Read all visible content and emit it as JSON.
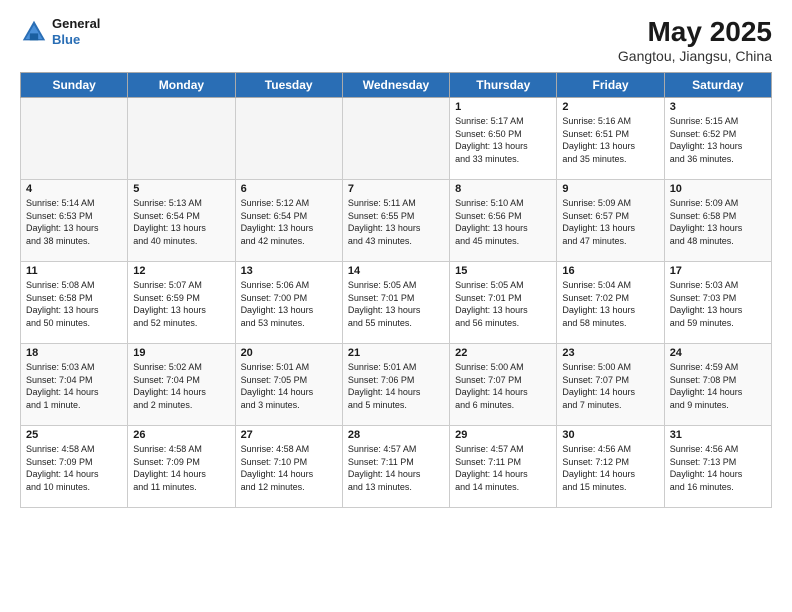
{
  "header": {
    "logo_general": "General",
    "logo_blue": "Blue",
    "title": "May 2025",
    "subtitle": "Gangtou, Jiangsu, China"
  },
  "days_of_week": [
    "Sunday",
    "Monday",
    "Tuesday",
    "Wednesday",
    "Thursday",
    "Friday",
    "Saturday"
  ],
  "weeks": [
    [
      {
        "day": "",
        "info": ""
      },
      {
        "day": "",
        "info": ""
      },
      {
        "day": "",
        "info": ""
      },
      {
        "day": "",
        "info": ""
      },
      {
        "day": "1",
        "info": "Sunrise: 5:17 AM\nSunset: 6:50 PM\nDaylight: 13 hours\nand 33 minutes."
      },
      {
        "day": "2",
        "info": "Sunrise: 5:16 AM\nSunset: 6:51 PM\nDaylight: 13 hours\nand 35 minutes."
      },
      {
        "day": "3",
        "info": "Sunrise: 5:15 AM\nSunset: 6:52 PM\nDaylight: 13 hours\nand 36 minutes."
      }
    ],
    [
      {
        "day": "4",
        "info": "Sunrise: 5:14 AM\nSunset: 6:53 PM\nDaylight: 13 hours\nand 38 minutes."
      },
      {
        "day": "5",
        "info": "Sunrise: 5:13 AM\nSunset: 6:54 PM\nDaylight: 13 hours\nand 40 minutes."
      },
      {
        "day": "6",
        "info": "Sunrise: 5:12 AM\nSunset: 6:54 PM\nDaylight: 13 hours\nand 42 minutes."
      },
      {
        "day": "7",
        "info": "Sunrise: 5:11 AM\nSunset: 6:55 PM\nDaylight: 13 hours\nand 43 minutes."
      },
      {
        "day": "8",
        "info": "Sunrise: 5:10 AM\nSunset: 6:56 PM\nDaylight: 13 hours\nand 45 minutes."
      },
      {
        "day": "9",
        "info": "Sunrise: 5:09 AM\nSunset: 6:57 PM\nDaylight: 13 hours\nand 47 minutes."
      },
      {
        "day": "10",
        "info": "Sunrise: 5:09 AM\nSunset: 6:58 PM\nDaylight: 13 hours\nand 48 minutes."
      }
    ],
    [
      {
        "day": "11",
        "info": "Sunrise: 5:08 AM\nSunset: 6:58 PM\nDaylight: 13 hours\nand 50 minutes."
      },
      {
        "day": "12",
        "info": "Sunrise: 5:07 AM\nSunset: 6:59 PM\nDaylight: 13 hours\nand 52 minutes."
      },
      {
        "day": "13",
        "info": "Sunrise: 5:06 AM\nSunset: 7:00 PM\nDaylight: 13 hours\nand 53 minutes."
      },
      {
        "day": "14",
        "info": "Sunrise: 5:05 AM\nSunset: 7:01 PM\nDaylight: 13 hours\nand 55 minutes."
      },
      {
        "day": "15",
        "info": "Sunrise: 5:05 AM\nSunset: 7:01 PM\nDaylight: 13 hours\nand 56 minutes."
      },
      {
        "day": "16",
        "info": "Sunrise: 5:04 AM\nSunset: 7:02 PM\nDaylight: 13 hours\nand 58 minutes."
      },
      {
        "day": "17",
        "info": "Sunrise: 5:03 AM\nSunset: 7:03 PM\nDaylight: 13 hours\nand 59 minutes."
      }
    ],
    [
      {
        "day": "18",
        "info": "Sunrise: 5:03 AM\nSunset: 7:04 PM\nDaylight: 14 hours\nand 1 minute."
      },
      {
        "day": "19",
        "info": "Sunrise: 5:02 AM\nSunset: 7:04 PM\nDaylight: 14 hours\nand 2 minutes."
      },
      {
        "day": "20",
        "info": "Sunrise: 5:01 AM\nSunset: 7:05 PM\nDaylight: 14 hours\nand 3 minutes."
      },
      {
        "day": "21",
        "info": "Sunrise: 5:01 AM\nSunset: 7:06 PM\nDaylight: 14 hours\nand 5 minutes."
      },
      {
        "day": "22",
        "info": "Sunrise: 5:00 AM\nSunset: 7:07 PM\nDaylight: 14 hours\nand 6 minutes."
      },
      {
        "day": "23",
        "info": "Sunrise: 5:00 AM\nSunset: 7:07 PM\nDaylight: 14 hours\nand 7 minutes."
      },
      {
        "day": "24",
        "info": "Sunrise: 4:59 AM\nSunset: 7:08 PM\nDaylight: 14 hours\nand 9 minutes."
      }
    ],
    [
      {
        "day": "25",
        "info": "Sunrise: 4:58 AM\nSunset: 7:09 PM\nDaylight: 14 hours\nand 10 minutes."
      },
      {
        "day": "26",
        "info": "Sunrise: 4:58 AM\nSunset: 7:09 PM\nDaylight: 14 hours\nand 11 minutes."
      },
      {
        "day": "27",
        "info": "Sunrise: 4:58 AM\nSunset: 7:10 PM\nDaylight: 14 hours\nand 12 minutes."
      },
      {
        "day": "28",
        "info": "Sunrise: 4:57 AM\nSunset: 7:11 PM\nDaylight: 14 hours\nand 13 minutes."
      },
      {
        "day": "29",
        "info": "Sunrise: 4:57 AM\nSunset: 7:11 PM\nDaylight: 14 hours\nand 14 minutes."
      },
      {
        "day": "30",
        "info": "Sunrise: 4:56 AM\nSunset: 7:12 PM\nDaylight: 14 hours\nand 15 minutes."
      },
      {
        "day": "31",
        "info": "Sunrise: 4:56 AM\nSunset: 7:13 PM\nDaylight: 14 hours\nand 16 minutes."
      }
    ]
  ]
}
